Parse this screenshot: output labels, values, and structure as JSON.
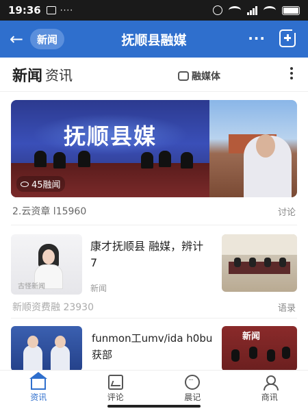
{
  "status_bar": {
    "time": "19:36",
    "dots": "····"
  },
  "header": {
    "back_label": "←",
    "pill_label": "新闻",
    "title": "抚顺县融媒",
    "more_label": "···"
  },
  "section": {
    "title_primary": "新闻",
    "title_secondary": "资讯",
    "brand": "融媒体"
  },
  "hero": {
    "banner_text": "抚顺县媒",
    "view_badge": "45融闻",
    "meta_left": "2.云资章 l15960",
    "meta_right": "讨论"
  },
  "items": [
    {
      "title_line1": "康才抚顺县 融媒，辨计",
      "title_line2": "7",
      "source": "新闻",
      "thumb_caption": "古怪新闻",
      "meta_left": "新顺资费融 23930",
      "meta_right": "语录"
    },
    {
      "title_line1": "funmon工umv/ida h0bu",
      "title_line2": "获部",
      "source": "",
      "news_label": "新闻"
    }
  ],
  "nav": [
    {
      "label": "资讯",
      "icon": "home-icon",
      "active": true
    },
    {
      "label": "评论",
      "icon": "image-icon",
      "active": false
    },
    {
      "label": "晨记",
      "icon": "chat-icon",
      "active": false
    },
    {
      "label": "商讯",
      "icon": "user-icon",
      "active": false
    }
  ],
  "colors": {
    "accent": "#2f6fcd",
    "header_bg": "#2f6fcd"
  }
}
